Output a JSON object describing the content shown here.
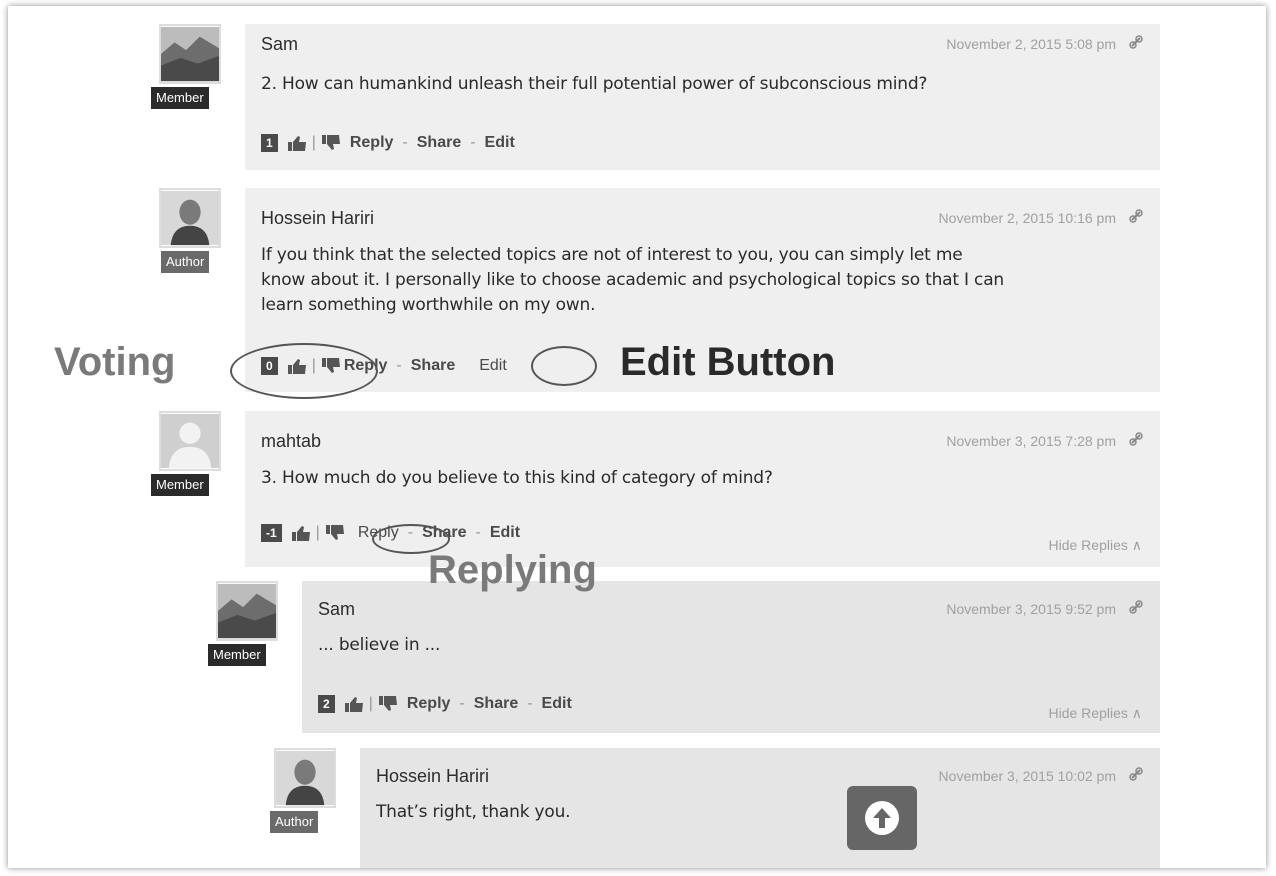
{
  "comments": [
    {
      "author": "Sam",
      "role": "Member",
      "date": "November 2, 2015 5:08 pm",
      "text": "2. How can humankind unleash their full potential power of subconscious mind?",
      "votes": "1",
      "reply": "Reply",
      "share": "Share",
      "edit": "Edit"
    },
    {
      "author": "Hossein Hariri",
      "role": "Author",
      "date": "November 2, 2015 10:16 pm",
      "text_lines": [
        "If you think that the selected topics are not of interest to you, you can simply let me",
        "know about it. I personally like to choose academic and psychological topics so that I can",
        "learn something worthwhile on my own."
      ],
      "votes": "0",
      "reply": "Reply",
      "share": "Share",
      "edit": "Edit"
    },
    {
      "author": "mahtab",
      "role": "Member",
      "date": "November 3, 2015 7:28 pm",
      "text": "3. How much do you believe to this kind of category of mind?",
      "votes": "-1",
      "reply": "Reply",
      "share": "Share",
      "edit": "Edit",
      "hide_replies": "Hide Replies ∧"
    },
    {
      "author": "Sam",
      "role": "Member",
      "date": "November 3, 2015 9:52 pm",
      "text": "... believe in ...",
      "votes": "2",
      "reply": "Reply",
      "share": "Share",
      "edit": "Edit",
      "hide_replies": "Hide Replies ∧"
    },
    {
      "author": "Hossein Hariri",
      "role": "Author",
      "date": "November 3, 2015 10:02 pm",
      "text": "That’s right, thank you."
    }
  ],
  "annotations": {
    "voting": "Voting",
    "edit_button": "Edit Button",
    "replying": "Replying"
  },
  "icons": {
    "permalink": "link-icon",
    "like": "thumbs-up-icon",
    "dislike": "thumbs-down-icon",
    "scroll_top": "arrow-up-icon"
  }
}
